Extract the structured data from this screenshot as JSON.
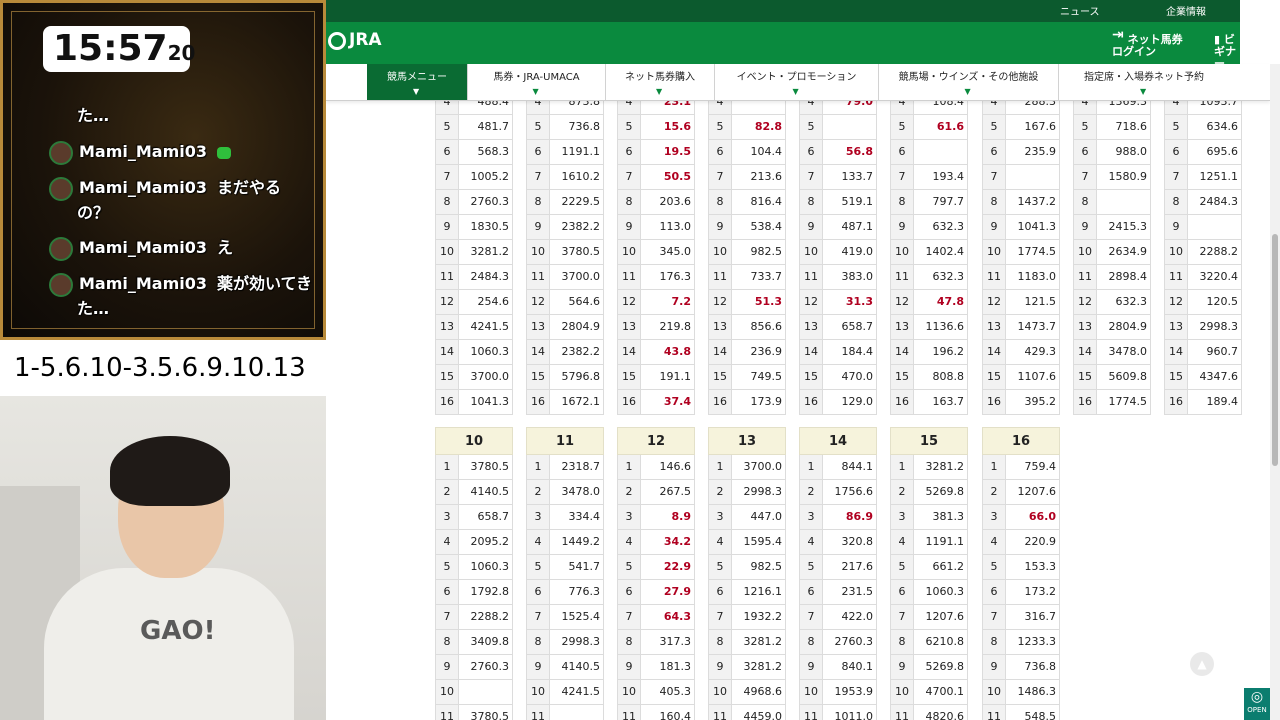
{
  "overlay": {
    "clock": {
      "hm": "15:57",
      "sec": "20"
    },
    "chat": [
      {
        "user": "",
        "text": "た…"
      },
      {
        "user": "Mami_Mami03",
        "text": ""
      },
      {
        "user": "Mami_Mami03",
        "text": "まだやる"
      },
      {
        "user": "",
        "text": "の？"
      },
      {
        "user": "Mami_Mami03",
        "text": "え"
      },
      {
        "user": "Mami_Mami03",
        "text": "薬が効いてき"
      },
      {
        "user": "",
        "text": "た…"
      }
    ],
    "caption": "1-5.6.10-3.5.6.9.10.13",
    "shirt_text": "GAO!"
  },
  "site": {
    "top_links": [
      "ニュース",
      "企業情報"
    ],
    "logo": "JRA",
    "login": "ネット馬券\nログイン",
    "beginner": "ビギナー",
    "nav": [
      "競馬メニュー",
      "馬券・JRA-UMACA",
      "ネット馬券購入",
      "イベント・プロモーション",
      "競馬場・ウインズ・その他施設",
      "指定席・入場券ネット予約"
    ],
    "open_label": "OPEN"
  },
  "upper_tables": [
    {
      "rows": [
        [
          "4",
          "488.4"
        ],
        [
          "5",
          "481.7"
        ],
        [
          "6",
          "568.3"
        ],
        [
          "7",
          "1005.2"
        ],
        [
          "8",
          "2760.3"
        ],
        [
          "9",
          "1830.5"
        ],
        [
          "10",
          "3281.2"
        ],
        [
          "11",
          "2484.3"
        ],
        [
          "12",
          "254.6"
        ],
        [
          "13",
          "4241.5"
        ],
        [
          "14",
          "1060.3"
        ],
        [
          "15",
          "3700.0"
        ],
        [
          "16",
          "1041.3"
        ]
      ]
    },
    {
      "rows": [
        [
          "4",
          "873.8"
        ],
        [
          "5",
          "736.8"
        ],
        [
          "6",
          "1191.1"
        ],
        [
          "7",
          "1610.2"
        ],
        [
          "8",
          "2229.5"
        ],
        [
          "9",
          "2382.2"
        ],
        [
          "10",
          "3780.5"
        ],
        [
          "11",
          "3700.0"
        ],
        [
          "12",
          "564.6"
        ],
        [
          "13",
          "2804.9"
        ],
        [
          "14",
          "2382.2"
        ],
        [
          "15",
          "5796.8"
        ],
        [
          "16",
          "1672.1"
        ]
      ]
    },
    {
      "rows": [
        [
          "4",
          "23.1"
        ],
        [
          "5",
          "15.6"
        ],
        [
          "6",
          "19.5"
        ],
        [
          "7",
          "50.5"
        ],
        [
          "8",
          "203.6"
        ],
        [
          "9",
          "113.0"
        ],
        [
          "10",
          "345.0"
        ],
        [
          "11",
          "176.3"
        ],
        [
          "12",
          "7.2"
        ],
        [
          "13",
          "219.8"
        ],
        [
          "14",
          "43.8"
        ],
        [
          "15",
          "191.1"
        ],
        [
          "16",
          "37.4"
        ]
      ]
    },
    {
      "rows": [
        [
          "4",
          ""
        ],
        [
          "5",
          "82.8"
        ],
        [
          "6",
          "104.4"
        ],
        [
          "7",
          "213.6"
        ],
        [
          "8",
          "816.4"
        ],
        [
          "9",
          "538.4"
        ],
        [
          "10",
          "982.5"
        ],
        [
          "11",
          "733.7"
        ],
        [
          "12",
          "51.3"
        ],
        [
          "13",
          "856.6"
        ],
        [
          "14",
          "236.9"
        ],
        [
          "15",
          "749.5"
        ],
        [
          "16",
          "173.9"
        ]
      ]
    },
    {
      "rows": [
        [
          "4",
          "79.0"
        ],
        [
          "5",
          ""
        ],
        [
          "6",
          "56.8"
        ],
        [
          "7",
          "133.7"
        ],
        [
          "8",
          "519.1"
        ],
        [
          "9",
          "487.1"
        ],
        [
          "10",
          "419.0"
        ],
        [
          "11",
          "383.0"
        ],
        [
          "12",
          "31.3"
        ],
        [
          "13",
          "658.7"
        ],
        [
          "14",
          "184.4"
        ],
        [
          "15",
          "470.0"
        ],
        [
          "16",
          "129.0"
        ]
      ]
    },
    {
      "rows": [
        [
          "4",
          "108.4"
        ],
        [
          "5",
          "61.6"
        ],
        [
          "6",
          ""
        ],
        [
          "7",
          "193.4"
        ],
        [
          "8",
          "797.7"
        ],
        [
          "9",
          "632.3"
        ],
        [
          "10",
          "1402.4"
        ],
        [
          "11",
          "632.3"
        ],
        [
          "12",
          "47.8"
        ],
        [
          "13",
          "1136.6"
        ],
        [
          "14",
          "196.2"
        ],
        [
          "15",
          "808.8"
        ],
        [
          "16",
          "163.7"
        ]
      ]
    },
    {
      "rows": [
        [
          "4",
          "288.3"
        ],
        [
          "5",
          "167.6"
        ],
        [
          "6",
          "235.9"
        ],
        [
          "7",
          ""
        ],
        [
          "8",
          "1437.2"
        ],
        [
          "9",
          "1041.3"
        ],
        [
          "10",
          "1774.5"
        ],
        [
          "11",
          "1183.0"
        ],
        [
          "12",
          "121.5"
        ],
        [
          "13",
          "1473.7"
        ],
        [
          "14",
          "429.3"
        ],
        [
          "15",
          "1107.6"
        ],
        [
          "16",
          "395.2"
        ]
      ]
    },
    {
      "rows": [
        [
          "4",
          "1369.3"
        ],
        [
          "5",
          "718.6"
        ],
        [
          "6",
          "988.0"
        ],
        [
          "7",
          "1580.9"
        ],
        [
          "8",
          ""
        ],
        [
          "9",
          "2415.3"
        ],
        [
          "10",
          "2634.9"
        ],
        [
          "11",
          "2898.4"
        ],
        [
          "12",
          "632.3"
        ],
        [
          "13",
          "2804.9"
        ],
        [
          "14",
          "3478.0"
        ],
        [
          "15",
          "5609.8"
        ],
        [
          "16",
          "1774.5"
        ]
      ]
    },
    {
      "rows": [
        [
          "4",
          "1093.7"
        ],
        [
          "5",
          "634.6"
        ],
        [
          "6",
          "695.6"
        ],
        [
          "7",
          "1251.1"
        ],
        [
          "8",
          "2484.3"
        ],
        [
          "9",
          ""
        ],
        [
          "10",
          "2288.2"
        ],
        [
          "11",
          "3220.4"
        ],
        [
          "12",
          "120.5"
        ],
        [
          "13",
          "2998.3"
        ],
        [
          "14",
          "960.7"
        ],
        [
          "15",
          "4347.6"
        ],
        [
          "16",
          "189.4"
        ]
      ]
    }
  ],
  "lower_tables": [
    {
      "head": "10",
      "rows": [
        [
          "1",
          "3780.5"
        ],
        [
          "2",
          "4140.5"
        ],
        [
          "3",
          "658.7"
        ],
        [
          "4",
          "2095.2"
        ],
        [
          "5",
          "1060.3"
        ],
        [
          "6",
          "1792.8"
        ],
        [
          "7",
          "2288.2"
        ],
        [
          "8",
          "3409.8"
        ],
        [
          "9",
          "2760.3"
        ],
        [
          "10",
          ""
        ],
        [
          "11",
          "3780.5"
        ]
      ]
    },
    {
      "head": "11",
      "rows": [
        [
          "1",
          "2318.7"
        ],
        [
          "2",
          "3478.0"
        ],
        [
          "3",
          "334.4"
        ],
        [
          "4",
          "1449.2"
        ],
        [
          "5",
          "541.7"
        ],
        [
          "6",
          "776.3"
        ],
        [
          "7",
          "1525.4"
        ],
        [
          "8",
          "2998.3"
        ],
        [
          "9",
          "4140.5"
        ],
        [
          "10",
          "4241.5"
        ],
        [
          "11",
          ""
        ]
      ]
    },
    {
      "head": "12",
      "rows": [
        [
          "1",
          "146.6"
        ],
        [
          "2",
          "267.5"
        ],
        [
          "3",
          "8.9"
        ],
        [
          "4",
          "34.2"
        ],
        [
          "5",
          "22.9"
        ],
        [
          "6",
          "27.9"
        ],
        [
          "7",
          "64.3"
        ],
        [
          "8",
          "317.3"
        ],
        [
          "9",
          "181.3"
        ],
        [
          "10",
          "405.3"
        ],
        [
          "11",
          "160.4"
        ]
      ]
    },
    {
      "head": "13",
      "rows": [
        [
          "1",
          "3700.0"
        ],
        [
          "2",
          "2998.3"
        ],
        [
          "3",
          "447.0"
        ],
        [
          "4",
          "1595.4"
        ],
        [
          "5",
          "982.5"
        ],
        [
          "6",
          "1216.1"
        ],
        [
          "7",
          "1932.2"
        ],
        [
          "8",
          "3281.2"
        ],
        [
          "9",
          "3281.2"
        ],
        [
          "10",
          "4968.6"
        ],
        [
          "11",
          "4459.0"
        ]
      ]
    },
    {
      "head": "14",
      "rows": [
        [
          "1",
          "844.1"
        ],
        [
          "2",
          "1756.6"
        ],
        [
          "3",
          "86.9"
        ],
        [
          "4",
          "320.8"
        ],
        [
          "5",
          "217.6"
        ],
        [
          "6",
          "231.5"
        ],
        [
          "7",
          "422.0"
        ],
        [
          "8",
          "2760.3"
        ],
        [
          "9",
          "840.1"
        ],
        [
          "10",
          "1953.9"
        ],
        [
          "11",
          "1011.0"
        ]
      ]
    },
    {
      "head": "15",
      "rows": [
        [
          "1",
          "3281.2"
        ],
        [
          "2",
          "5269.8"
        ],
        [
          "3",
          "381.3"
        ],
        [
          "4",
          "1191.1"
        ],
        [
          "5",
          "661.2"
        ],
        [
          "6",
          "1060.3"
        ],
        [
          "7",
          "1207.6"
        ],
        [
          "8",
          "6210.8"
        ],
        [
          "9",
          "5269.8"
        ],
        [
          "10",
          "4700.1"
        ],
        [
          "11",
          "4820.6"
        ]
      ]
    },
    {
      "head": "16",
      "rows": [
        [
          "1",
          "759.4"
        ],
        [
          "2",
          "1207.6"
        ],
        [
          "3",
          "66.0"
        ],
        [
          "4",
          "220.9"
        ],
        [
          "5",
          "153.3"
        ],
        [
          "6",
          "173.2"
        ],
        [
          "7",
          "316.7"
        ],
        [
          "8",
          "1233.3"
        ],
        [
          "9",
          "736.8"
        ],
        [
          "10",
          "1486.3"
        ],
        [
          "11",
          "548.5"
        ]
      ]
    }
  ],
  "colors": {
    "jra_green": "#0a8a3e",
    "odds_red": "#b00020"
  }
}
